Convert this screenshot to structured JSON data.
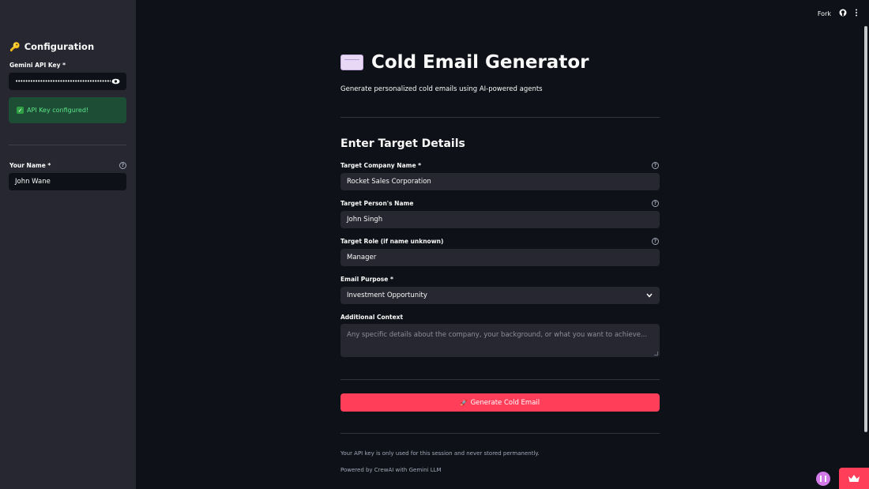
{
  "sidebar": {
    "title": "Configuration",
    "title_icon": "🔑",
    "api_key_label": "Gemini API Key *",
    "api_key_value": "••••••••••••••••••••••••••••••••••••••••",
    "success_text": "API Key configured!",
    "your_name_label": "Your Name *",
    "your_name_value": "John Wane"
  },
  "header": {
    "fork_label": "Fork"
  },
  "main": {
    "title": "Cold Email Generator",
    "subtitle": "Generate personalized cold emails using AI-powered agents",
    "section_title": "Enter Target Details",
    "fields": {
      "company_label": "Target Company Name *",
      "company_value": "Rocket Sales Corporation",
      "person_label": "Target Person's Name",
      "person_value": "John Singh",
      "role_label": "Target Role (if name unknown)",
      "role_value": "Manager",
      "purpose_label": "Email Purpose *",
      "purpose_value": "Investment Opportunity",
      "context_label": "Additional Context",
      "context_placeholder": "Any specific details about the company, your background, or what you want to achieve..."
    },
    "generate_button": "Generate Cold Email",
    "footer_note": "Your API key is only used for this session and never stored permanently.",
    "footer_powered": "Powered by CrewAI with Gemini LLM"
  },
  "colors": {
    "primary": "#ff3f5a",
    "sidebar_bg": "#262730",
    "app_bg": "#0e1117",
    "success_bg": "#1d4d35",
    "success_text": "#5ce488"
  }
}
